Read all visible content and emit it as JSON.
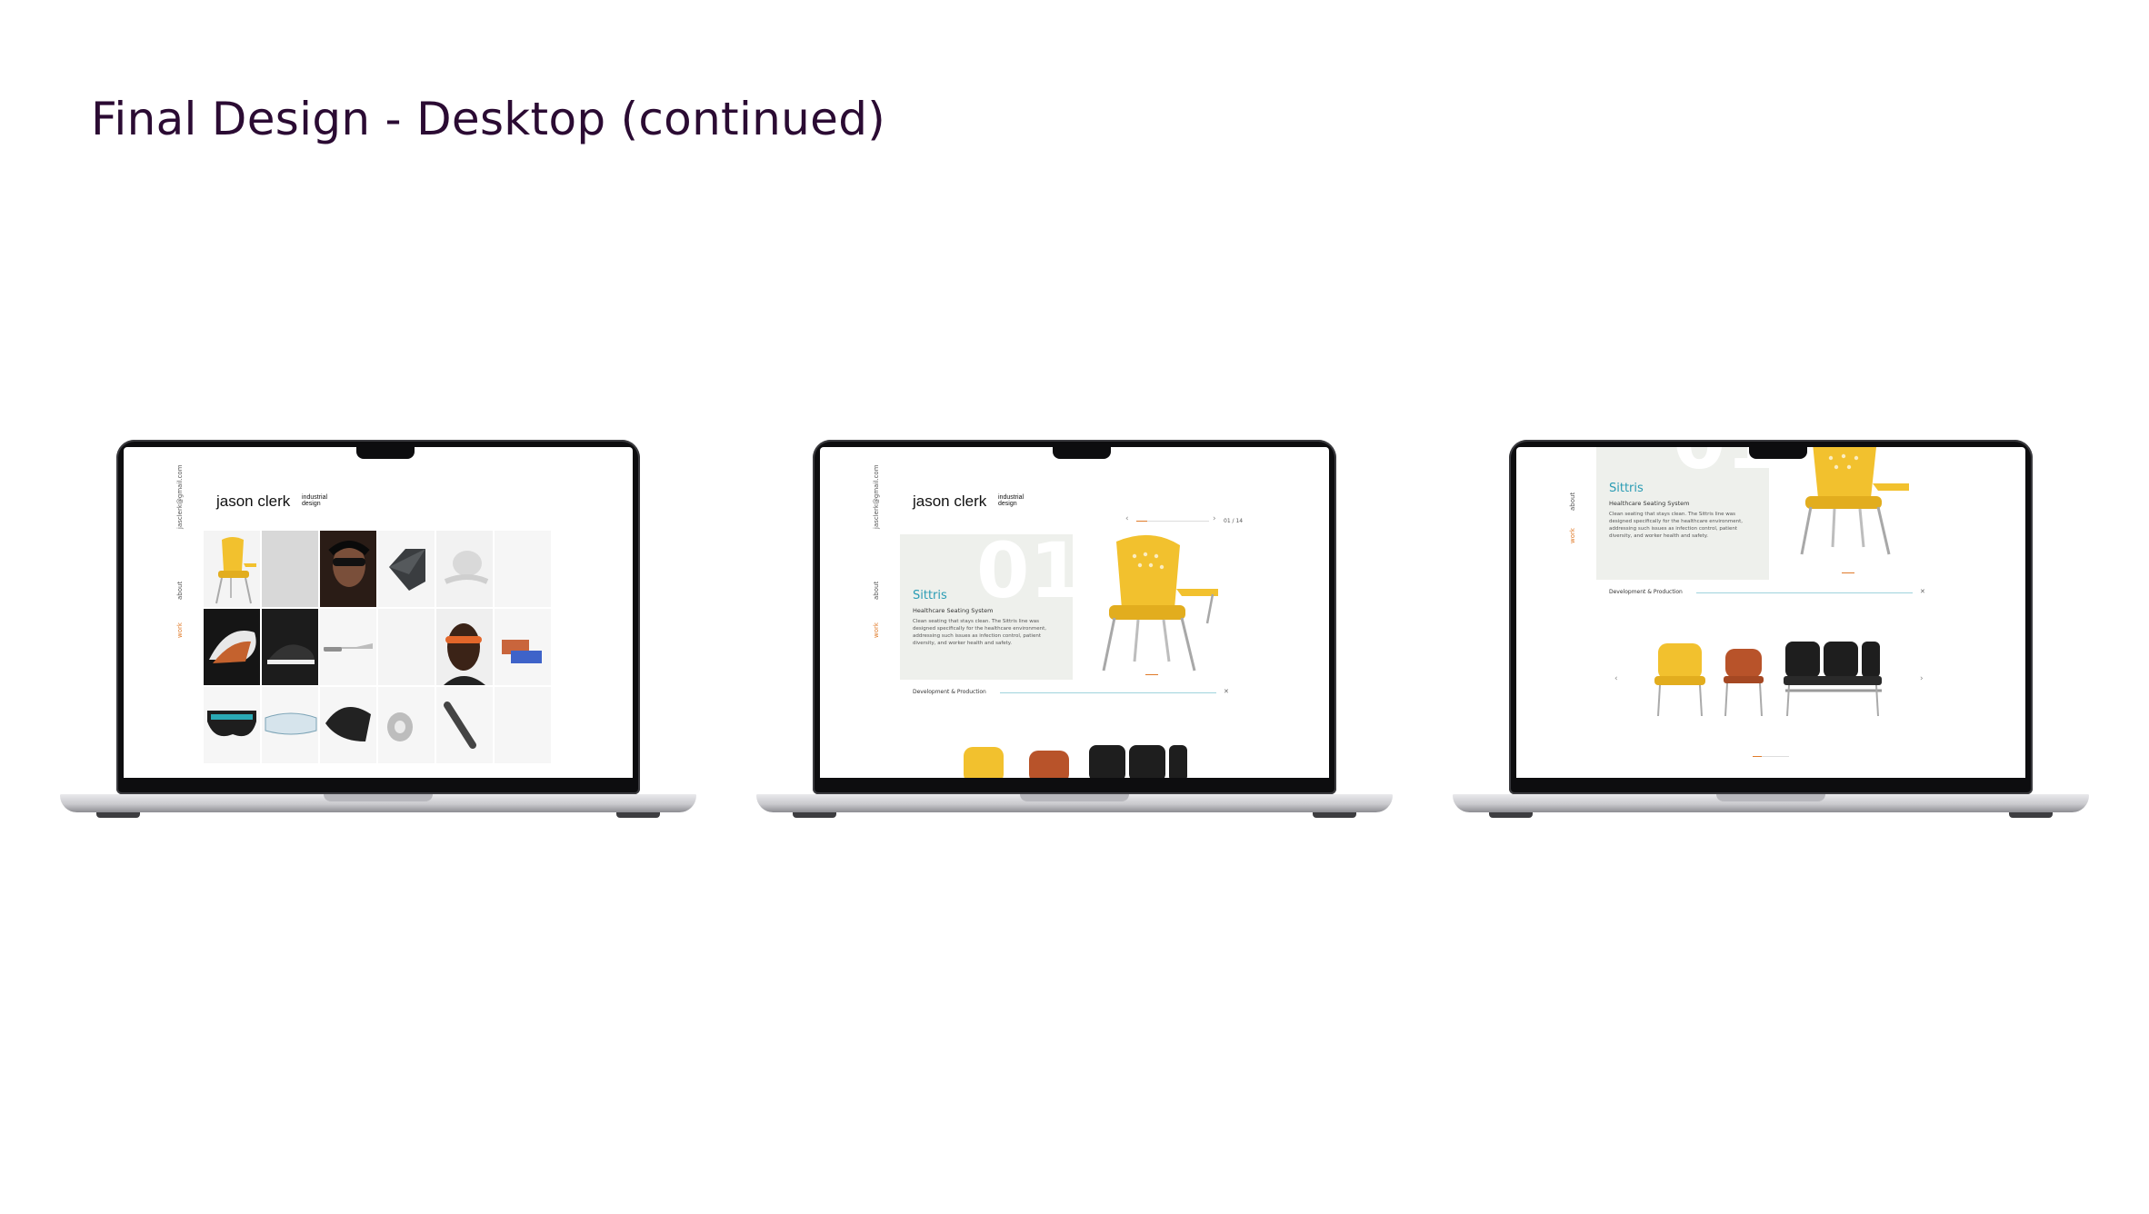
{
  "heading": "Final Design - Desktop (continued)",
  "site": {
    "logo": "jason clerk",
    "logo_sub": "industrial design",
    "email": "jasclerk@gmail.com",
    "nav": {
      "about": "about",
      "work": "work"
    }
  },
  "project": {
    "number": "01",
    "title": "Sittris",
    "subtitle": "Healthcare Seating System",
    "body": "Clean seating that stays clean. The Sittris line was designed specifically for the healthcare environment, addressing such issues as infection control, patient diversity, and worker health and safety.",
    "section": "Development & Production",
    "pager": "01 / 14"
  },
  "icons": {
    "prev": "chevron-left-icon",
    "next": "chevron-right-icon",
    "close": "close-icon"
  },
  "colors": {
    "heading": "#2b0b33",
    "accent_teal": "#2a9cb4",
    "accent_orange": "#e07b2a",
    "chair_yellow": "#f2c12e",
    "chair_rust": "#b8532a"
  }
}
